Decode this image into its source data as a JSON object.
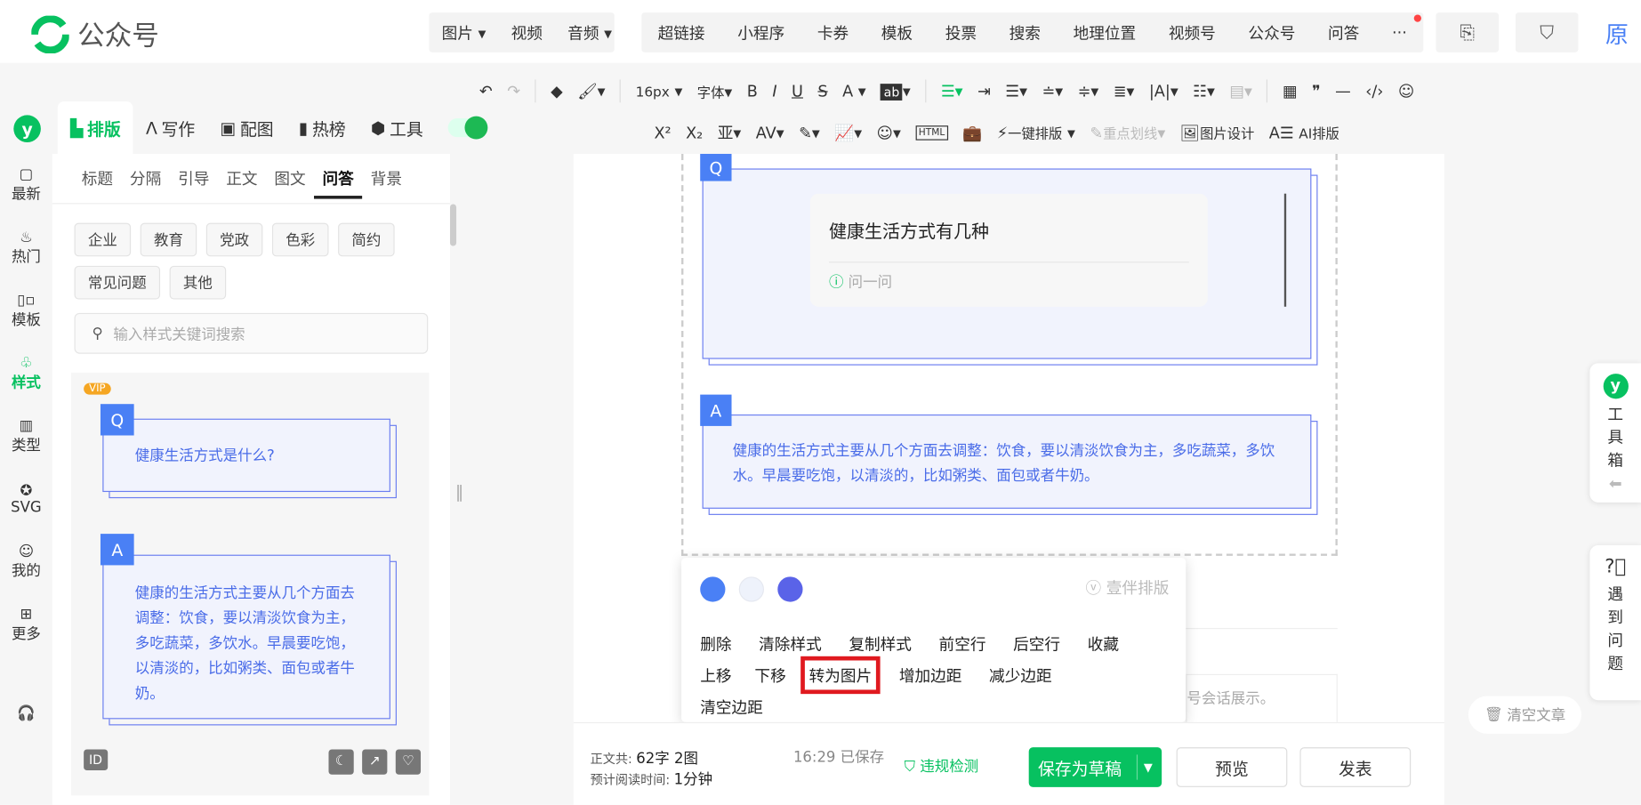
{
  "header": {
    "app_title": "公众号",
    "media_group": [
      "图片",
      "视频",
      "音频"
    ],
    "insert_group": [
      "超链接",
      "小程序",
      "卡券",
      "模板",
      "投票",
      "搜索",
      "地理位置",
      "视频号",
      "公众号",
      "问答"
    ],
    "more": "···",
    "partial_char": "原"
  },
  "toolbar": {
    "font_size": "16px",
    "font_family": "字体",
    "bold": "B",
    "italic": "I",
    "underline": "U",
    "strike": "S",
    "font_color": "A",
    "bg_color": "ab",
    "superscript": "X²",
    "subscript": "X₂",
    "one_click": "一键排版",
    "highlight_line": "重点划线",
    "image_design": "图片设计",
    "ai_layout": "AI排版",
    "html": "HTML"
  },
  "left_tabs": [
    {
      "label": "排版",
      "active": true
    },
    {
      "label": "写作"
    },
    {
      "label": "配图"
    },
    {
      "label": "热榜"
    },
    {
      "label": "工具"
    }
  ],
  "rail": [
    {
      "label": "最新",
      "icon": "chat-icon"
    },
    {
      "label": "热门",
      "icon": "fire-icon"
    },
    {
      "label": "模板",
      "icon": "template-icon"
    },
    {
      "label": "样式",
      "icon": "style-icon",
      "active": true
    },
    {
      "label": "类型",
      "icon": "type-icon"
    },
    {
      "label": "SVG",
      "icon": "svg-icon"
    },
    {
      "label": "我的",
      "icon": "user-icon"
    },
    {
      "label": "更多",
      "icon": "grid-icon"
    }
  ],
  "panel": {
    "subtabs": [
      "标题",
      "分隔",
      "引导",
      "正文",
      "图文",
      "问答",
      "背景"
    ],
    "active_subtab": "问答",
    "tags": [
      "企业",
      "教育",
      "党政",
      "色彩",
      "简约",
      "常见问题",
      "其他"
    ],
    "search_placeholder": "输入样式关键词搜索",
    "card": {
      "vip": "VIP",
      "q_badge": "Q",
      "question": "健康生活方式是什么?",
      "a_badge": "A",
      "answer": "健康的生活方式主要从几个方面去调整：饮食，要以清淡饮食为主，多吃蔬菜，多饮水。早晨要吃饱，以清淡的，比如粥类、面包或者牛奶。",
      "id_label": "ID"
    }
  },
  "editor": {
    "q_badge": "Q",
    "question": "健康生活方式有几种",
    "ask": "问一问",
    "a_badge": "A",
    "answer": "健康的生活方式主要从几个方面去调整：饮食，要以清淡饮食为主，多吃蔬菜，多饮水。早晨要吃饱，以清淡的，比如粥类、面包或者牛奶。",
    "behind_text": "号会话展示。"
  },
  "popup": {
    "colors": [
      "#4a80f5",
      "#eef2fb",
      "#5a63e8"
    ],
    "brand": "壹伴排版",
    "actions": [
      "删除",
      "清除样式",
      "复制样式",
      "前空行",
      "后空行",
      "收藏",
      "上移",
      "下移",
      "转为图片",
      "增加边距",
      "减少边距",
      "清空边距"
    ],
    "highlighted": "转为图片"
  },
  "status": {
    "count_label": "正文共:",
    "count": "62字 2图",
    "read_label": "预计阅读时间:",
    "read_time": "1分钟",
    "time": "16:29",
    "saved": "已保存",
    "check": "违规检测",
    "save_draft": "保存为草稿",
    "preview": "预览",
    "publish": "发表"
  },
  "side": {
    "toolbox": "工具箱",
    "problem": "遇到问题",
    "clear": "清空文章"
  },
  "colors": {
    "accent": "#07c160",
    "blue": "#4a80f5",
    "highlight": "#e0191f"
  }
}
